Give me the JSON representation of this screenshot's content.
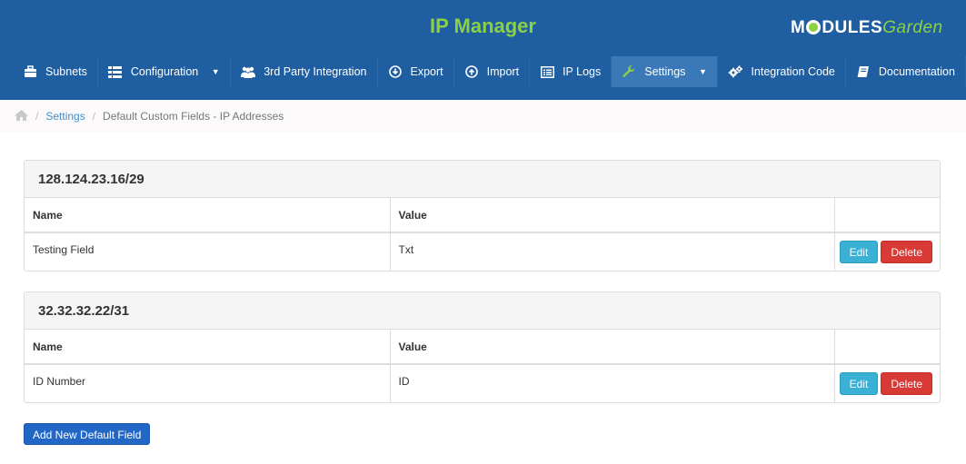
{
  "header": {
    "title": "IP Manager",
    "logo": {
      "part1": "M",
      "part2": "DULES",
      "part3": "Garden"
    }
  },
  "nav": [
    {
      "label": "Subnets",
      "icon": "briefcase-icon"
    },
    {
      "label": "Configuration",
      "icon": "grid-icon",
      "dropdown": true
    },
    {
      "label": "3rd Party Integration",
      "icon": "users-icon"
    },
    {
      "label": "Export",
      "icon": "download-icon"
    },
    {
      "label": "Import",
      "icon": "upload-icon"
    },
    {
      "label": "IP Logs",
      "icon": "list-icon"
    },
    {
      "label": "Settings",
      "icon": "wrench-icon",
      "dropdown": true,
      "active": true
    },
    {
      "label": "Integration Code",
      "icon": "cogs-icon"
    },
    {
      "label": "Documentation",
      "icon": "book-icon"
    }
  ],
  "breadcrumb": {
    "home_icon": "home-icon",
    "link": "Settings",
    "current": "Default Custom Fields - IP Addresses"
  },
  "panels": [
    {
      "title": "128.124.23.16/29",
      "columns": [
        "Name",
        "Value",
        ""
      ],
      "rows": [
        {
          "name": "Testing Field",
          "value": "Txt"
        }
      ]
    },
    {
      "title": "32.32.32.22/31",
      "columns": [
        "Name",
        "Value",
        ""
      ],
      "rows": [
        {
          "name": "ID Number",
          "value": "ID"
        }
      ]
    }
  ],
  "actions": {
    "edit": "Edit",
    "delete": "Delete",
    "add": "Add New Default Field"
  },
  "colors": {
    "header": "#1f5ea1",
    "title": "#8cd142",
    "edit": "#3ab0d4",
    "delete": "#d83a36",
    "add": "#2267c6"
  }
}
